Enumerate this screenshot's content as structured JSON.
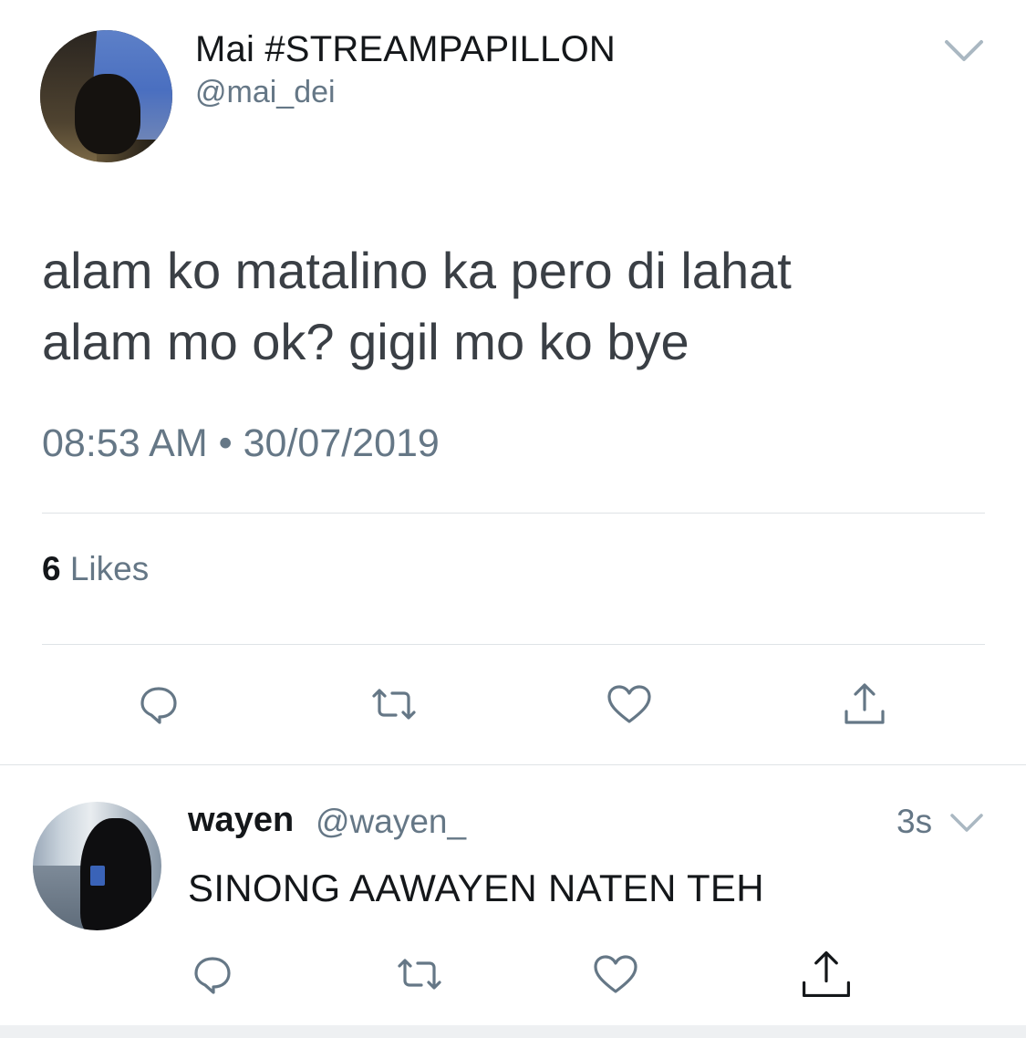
{
  "main_tweet": {
    "display_name": "Mai #STREAMPAPILLON",
    "handle": "@mai_dei",
    "text_line1": "alam ko matalino ka pero di lahat",
    "text_line2": "alam mo ok? gigil mo ko bye",
    "timestamp": "08:53 AM • 30/07/2019",
    "likes_count": "6",
    "likes_label": "Likes",
    "actions": [
      "reply-icon",
      "retweet-icon",
      "like-icon",
      "share-icon"
    ]
  },
  "reply_tweet": {
    "display_name": "wayen",
    "handle": "@wayen_",
    "time_ago": "3s",
    "text": "SINONG AAWAYEN NATEN TEH",
    "actions": [
      "reply-icon",
      "retweet-icon",
      "like-icon",
      "share-icon"
    ]
  },
  "colors": {
    "secondary_text": "#657786",
    "icon": "#657786",
    "divider": "#dfe3e6"
  }
}
